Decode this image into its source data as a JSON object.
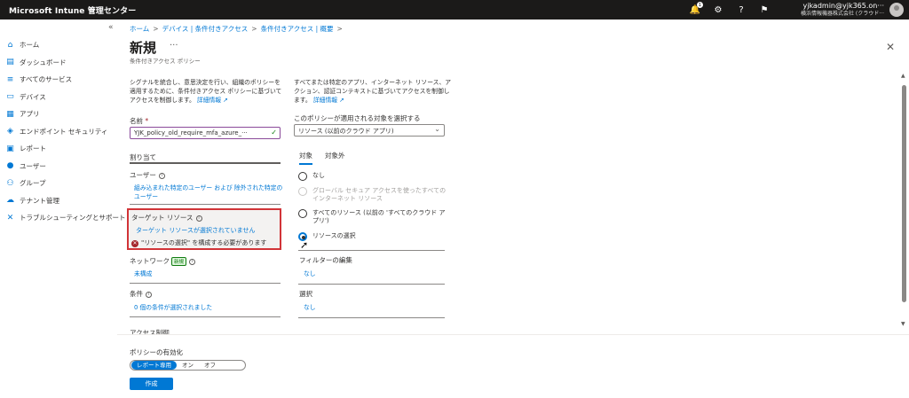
{
  "topbar": {
    "brand": "Microsoft Intune 管理センター",
    "notif_count": "1",
    "user": "yjkadmin@yjk365.on···",
    "tenant": "横浜情報機器株式会社 (クラウド···"
  },
  "sidebar": {
    "items": [
      {
        "label": "ホーム",
        "icon": "home-icon"
      },
      {
        "label": "ダッシュボード",
        "icon": "dashboard-icon"
      },
      {
        "label": "すべてのサービス",
        "icon": "list-icon"
      },
      {
        "label": "デバイス",
        "icon": "device-icon"
      },
      {
        "label": "アプリ",
        "icon": "apps-icon"
      },
      {
        "label": "エンドポイント セキュリティ",
        "icon": "shield-icon"
      },
      {
        "label": "レポート",
        "icon": "report-icon"
      },
      {
        "label": "ユーザー",
        "icon": "user-icon"
      },
      {
        "label": "グループ",
        "icon": "group-icon"
      },
      {
        "label": "テナント管理",
        "icon": "tenant-icon"
      },
      {
        "label": "トラブルシューティングとサポート",
        "icon": "wrench-icon"
      }
    ]
  },
  "breadcrumb": [
    "ホーム",
    "デバイス | 条件付きアクセス",
    "条件付きアクセス | 概要"
  ],
  "page": {
    "title": "新規",
    "subtitle": "条件付きアクセス ポリシー"
  },
  "left": {
    "desc": "シグナルを統合し、意思決定を行い、組織のポリシーを適用するために、条件付きアクセス ポリシーに基づいてアクセスを制御します。",
    "desc_link": "詳細情報",
    "name_label": "名前",
    "name_value": "YJK_policy_old_require_mfa_azure_···",
    "assign_header": "割り当て",
    "users_label": "ユーザー",
    "users_value": "組み込まれた特定のユーザー および 除外された特定のユーザー",
    "target_label": "ターゲット リソース",
    "target_value": "ターゲット リソースが選択されていません",
    "target_error": "\"リソースの選択\" を構成する必要があります",
    "network_label": "ネットワーク",
    "network_badge": "新規",
    "network_value": "未構成",
    "conditions_label": "条件",
    "conditions_value": "0 個の条件が選択されました",
    "access_cut": "アクセス制御"
  },
  "right": {
    "desc": "すべてまたは特定のアプリ、インターネット リソース、アクション、認証コンテキストに基づいてアクセスを制御します。",
    "desc_link": "詳細情報",
    "apply_label": "このポリシーが適用される対象を選択する",
    "apply_value": "リソース (以前のクラウド アプリ)",
    "tabs": [
      "対象",
      "対象外"
    ],
    "radios": [
      {
        "label": "なし"
      },
      {
        "label": "グローバル セキュア アクセスを使ったすべてのインターネット リソース"
      },
      {
        "label": "すべてのリソース (以前の 'すべてのクラウド アプリ')"
      },
      {
        "label": "リソースの選択"
      }
    ],
    "filter_label": "フィルターの編集",
    "filter_value": "なし",
    "select_label": "選択",
    "select_value": "なし"
  },
  "footer": {
    "label": "ポリシーの有効化",
    "options": [
      "レポート専用",
      "オン",
      "オフ"
    ],
    "create": "作成"
  }
}
